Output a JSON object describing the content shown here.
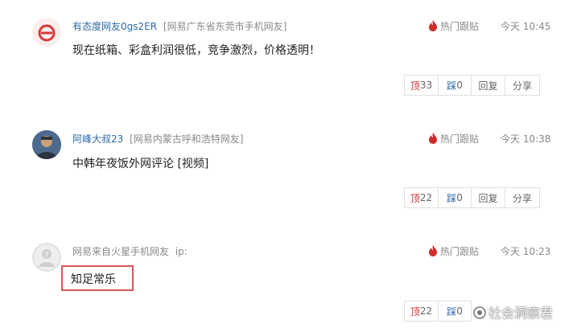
{
  "comments": [
    {
      "username": "有态度网友0gs2ER",
      "location": "[网易广东省东莞市手机网友]",
      "hot_label": "热门跟贴",
      "time": "今天 10:45",
      "text": "现在纸箱、彩盒利润很低，竞争激烈，价格透明！",
      "up_label": "顶",
      "up_count": "33",
      "down_label": "踩",
      "down_count": "0",
      "reply_label": "回复",
      "share_label": "分享"
    },
    {
      "username": "阿峰大叔23",
      "location": "[网易内蒙古呼和浩特网友]",
      "hot_label": "热门跟贴",
      "time": "今天 10:38",
      "text": "中韩年夜饭外网评论 [视频]",
      "up_label": "顶",
      "up_count": "22",
      "down_label": "踩",
      "down_count": "0",
      "reply_label": "回复",
      "share_label": "分享"
    },
    {
      "username": "网易来自火星手机网友",
      "location": "ip:",
      "hot_label": "热门跟贴",
      "time": "今天 10:23",
      "text": "知足常乐",
      "up_label": "顶",
      "up_count": "22",
      "down_label": "踩",
      "down_count": "0"
    }
  ],
  "watermark": "社会洞察君",
  "colors": {
    "accent_red": "#d12c2c",
    "link_blue": "#2e6aa8",
    "highlight_border": "#d9555b"
  }
}
